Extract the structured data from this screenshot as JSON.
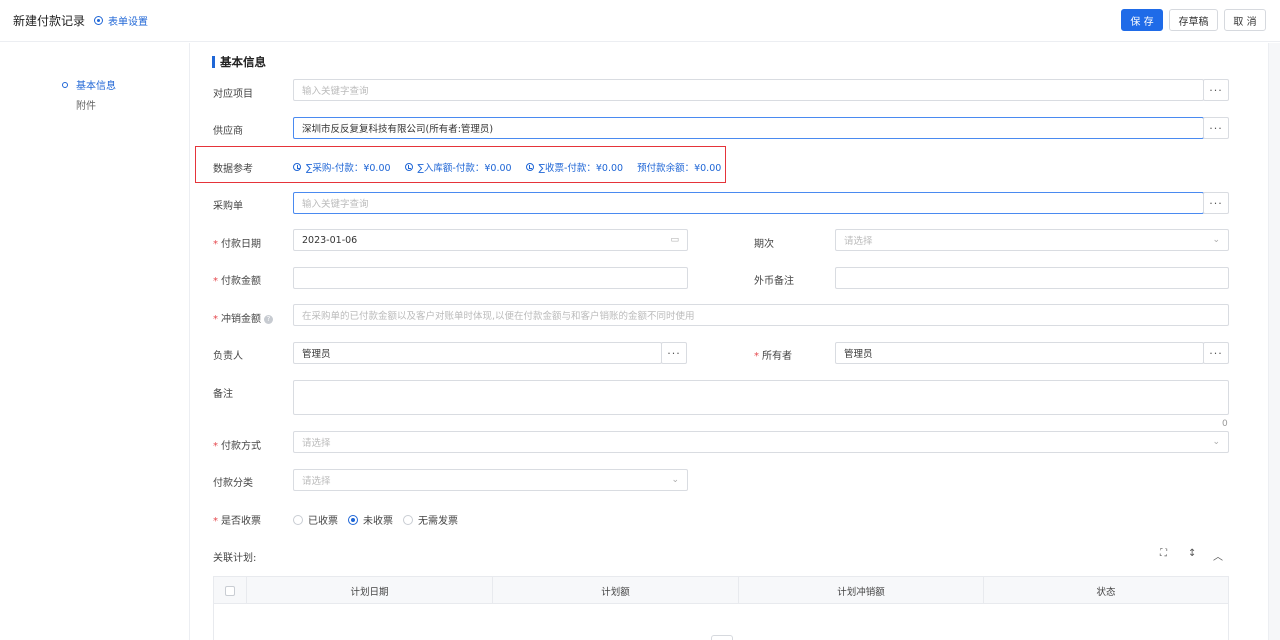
{
  "header": {
    "title": "新建付款记录",
    "form_settings": "表单设置",
    "save": "保 存",
    "draft": "存草稿",
    "cancel": "取 消"
  },
  "nav": {
    "items": [
      {
        "label": "基本信息",
        "active": true
      },
      {
        "label": "附件",
        "active": false
      }
    ]
  },
  "section": {
    "title": "基本信息"
  },
  "fields": {
    "project": {
      "label": "对应项目",
      "placeholder": "输入关键字查询"
    },
    "supplier": {
      "label": "供应商",
      "value": "深圳市反反复复科技有限公司(所有者:管理员)"
    },
    "data_ref": {
      "label": "数据参考",
      "items": [
        "∑采购-付款：¥0.00",
        "∑入库额-付款：¥0.00",
        "∑收票-付款：¥0.00",
        "预付款余额：¥0.00"
      ]
    },
    "purchase_order": {
      "label": "采购单",
      "placeholder": "输入关键字查询"
    },
    "pay_date": {
      "label": "付款日期",
      "value": "2023-01-06"
    },
    "period": {
      "label": "期次",
      "placeholder": "请选择"
    },
    "pay_amount": {
      "label": "付款金额",
      "value": ""
    },
    "fx_note": {
      "label": "外币备注",
      "value": ""
    },
    "offset_amount": {
      "label": "冲销金额",
      "placeholder": "在采购单的已付款金额以及客户对账单时体现,以便在付款金额与和客户销账的金额不同时使用"
    },
    "owner_person": {
      "label": "负责人",
      "value": "管理员"
    },
    "owner": {
      "label": "所有者",
      "value": "管理员"
    },
    "remark": {
      "label": "备注",
      "counter": "0"
    },
    "pay_method": {
      "label": "付款方式",
      "placeholder": "请选择"
    },
    "pay_category": {
      "label": "付款分类",
      "placeholder": "请选择"
    },
    "invoice": {
      "label": "是否收票",
      "options": [
        "已收票",
        "未收票",
        "无需发票"
      ],
      "selected": "未收票"
    }
  },
  "plan": {
    "label": "关联计划:",
    "columns": [
      "计划日期",
      "计划额",
      "计划冲销额",
      "状态"
    ]
  },
  "colors": {
    "primary": "#1f6be8",
    "highlight": "#e5343a",
    "required": "#e5484d"
  }
}
